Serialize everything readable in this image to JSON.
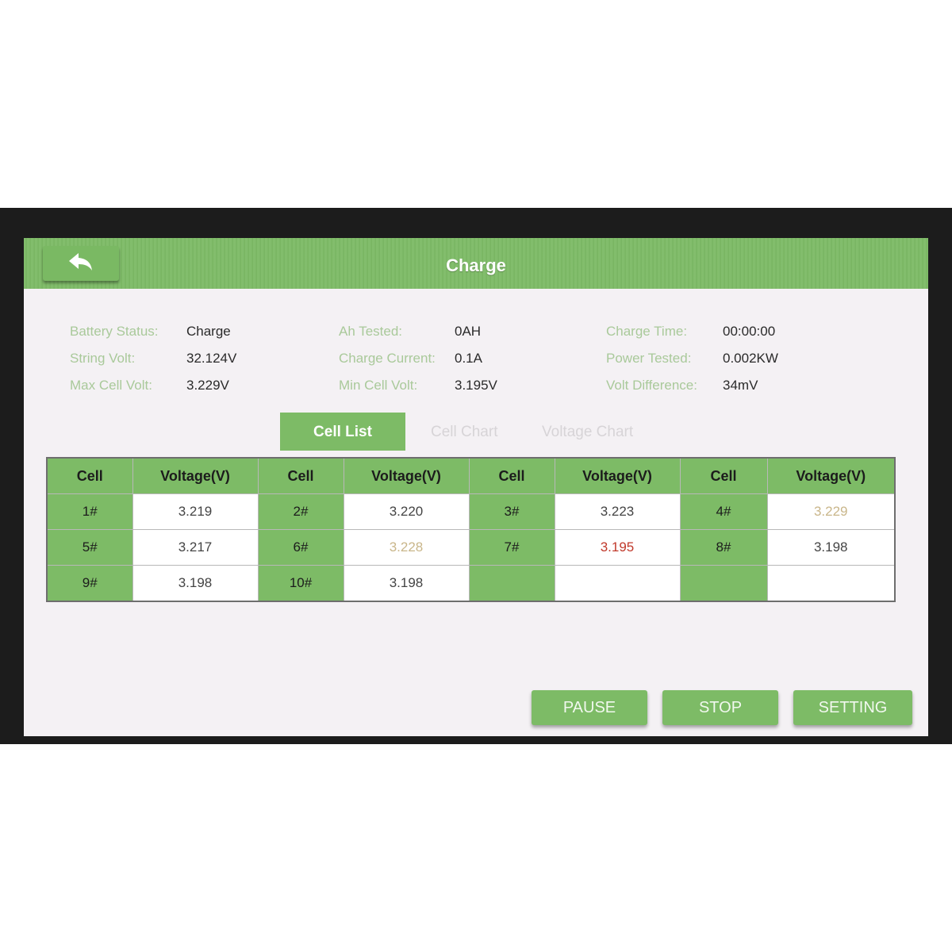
{
  "header": {
    "back_icon": "back-arrow-icon",
    "title": "Charge"
  },
  "info": {
    "battery_status": {
      "label": "Battery Status:",
      "value": "Charge"
    },
    "string_volt": {
      "label": "String Volt:",
      "value": "32.124V"
    },
    "max_cell_volt": {
      "label": "Max Cell Volt:",
      "value": "3.229V"
    },
    "ah_tested": {
      "label": "Ah Tested:",
      "value": "0AH"
    },
    "charge_current": {
      "label": "Charge Current:",
      "value": "0.1A"
    },
    "min_cell_volt": {
      "label": "Min Cell Volt:",
      "value": "3.195V"
    },
    "charge_time": {
      "label": "Charge Time:",
      "value": "00:00:00"
    },
    "power_tested": {
      "label": "Power Tested:",
      "value": "0.002KW"
    },
    "volt_difference": {
      "label": "Volt Difference:",
      "value": "34mV"
    }
  },
  "tabs": {
    "cell_list": "Cell List",
    "cell_chart": "Cell Chart",
    "voltage_chart": "Voltage Chart"
  },
  "table": {
    "headers": [
      "Cell",
      "Voltage(V)",
      "Cell",
      "Voltage(V)",
      "Cell",
      "Voltage(V)",
      "Cell",
      "Voltage(V)"
    ],
    "rows": [
      [
        {
          "cell": "1#",
          "volt": "3.219"
        },
        {
          "cell": "2#",
          "volt": "3.220"
        },
        {
          "cell": "3#",
          "volt": "3.223"
        },
        {
          "cell": "4#",
          "volt": "3.229"
        }
      ],
      [
        {
          "cell": "5#",
          "volt": "3.217"
        },
        {
          "cell": "6#",
          "volt": "3.228"
        },
        {
          "cell": "7#",
          "volt": "3.195"
        },
        {
          "cell": "8#",
          "volt": "3.198"
        }
      ],
      [
        {
          "cell": "9#",
          "volt": "3.198"
        },
        {
          "cell": "10#",
          "volt": "3.198"
        },
        {
          "cell": "",
          "volt": ""
        },
        {
          "cell": "",
          "volt": ""
        }
      ]
    ],
    "colors": {
      "max_highlight": "#c9b68a",
      "min_highlight": "#c0392b",
      "normal": "#444444"
    }
  },
  "buttons": {
    "pause": "PAUSE",
    "stop": "STOP",
    "setting": "SETTING"
  },
  "theme": {
    "accent": "#7dbb66",
    "label_color": "#a9c99a"
  }
}
